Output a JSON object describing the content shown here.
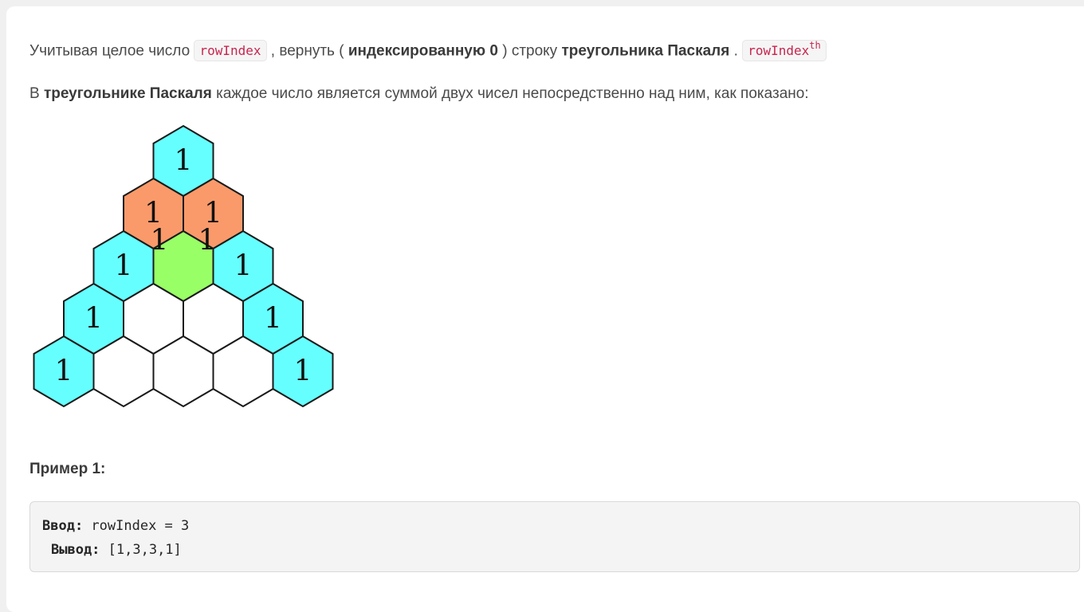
{
  "problem": {
    "p1": {
      "t1": "Учитывая целое число ",
      "code1": "rowIndex",
      "t2": " , вернуть ( ",
      "b1": "индексированную 0",
      "t3": " ) строку ",
      "b2": "треугольника Паскаля",
      "t4": " . ",
      "code2": "rowIndex",
      "sup": "th"
    },
    "p2": {
      "t1": "В ",
      "b1": "треугольнике Паскаля",
      "t2": " каждое число является суммой двух чисел непосредственно над ним, как показано:"
    }
  },
  "figure": {
    "colors": {
      "cyan": "#66ffff",
      "orange": "#fa9a6a",
      "green": "#99ff66",
      "white": "#ffffff"
    },
    "rows": [
      [
        {
          "label": "1",
          "color": "cyan"
        }
      ],
      [
        {
          "label": "1",
          "color": "orange"
        },
        {
          "label": "1",
          "color": "orange"
        }
      ],
      [
        {
          "label": "1",
          "color": "cyan"
        },
        {
          "label": "",
          "color": "green"
        },
        {
          "label": "1",
          "color": "cyan"
        }
      ],
      [
        {
          "label": "1",
          "color": "cyan"
        },
        {
          "label": "",
          "color": "white"
        },
        {
          "label": "",
          "color": "white"
        },
        {
          "label": "1",
          "color": "cyan"
        }
      ],
      [
        {
          "label": "1",
          "color": "cyan"
        },
        {
          "label": "",
          "color": "white"
        },
        {
          "label": "",
          "color": "white"
        },
        {
          "label": "",
          "color": "white"
        },
        {
          "label": "1",
          "color": "cyan"
        }
      ]
    ],
    "overlay_labels": [
      "1",
      "1"
    ]
  },
  "example": {
    "title": "Пример 1:",
    "input_label": "Ввод:",
    "input_value": " rowIndex = 3",
    "output_label": "Вывод:",
    "output_value": " [1,3,3,1]"
  }
}
